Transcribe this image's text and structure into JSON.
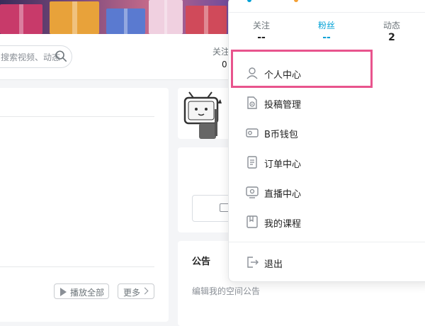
{
  "search": {
    "placeholder": "搜索视频、动态"
  },
  "nav": {
    "follow_label": "关注",
    "follow_count": "0"
  },
  "main": {
    "play_all_label": "播放全部",
    "more_label": "更多"
  },
  "notice": {
    "title": "公告",
    "body": "编辑我的空间公告"
  },
  "dropdown": {
    "stats": [
      {
        "label": "关注",
        "value": "--"
      },
      {
        "label": "粉丝",
        "value": "--"
      },
      {
        "label": "动态",
        "value": "2"
      }
    ],
    "menu": [
      {
        "label": "个人中心",
        "icon": "user-icon"
      },
      {
        "label": "投稿管理",
        "icon": "upload-manage-icon"
      },
      {
        "label": "B币钱包",
        "icon": "wallet-icon"
      },
      {
        "label": "订单中心",
        "icon": "order-icon"
      },
      {
        "label": "直播中心",
        "icon": "live-icon"
      },
      {
        "label": "我的课程",
        "icon": "course-icon"
      }
    ],
    "logout_label": "退出"
  },
  "colors": {
    "accent": "#00a1d6",
    "highlight": "#e8548d",
    "text": "#222222",
    "muted": "#8a8f96"
  }
}
